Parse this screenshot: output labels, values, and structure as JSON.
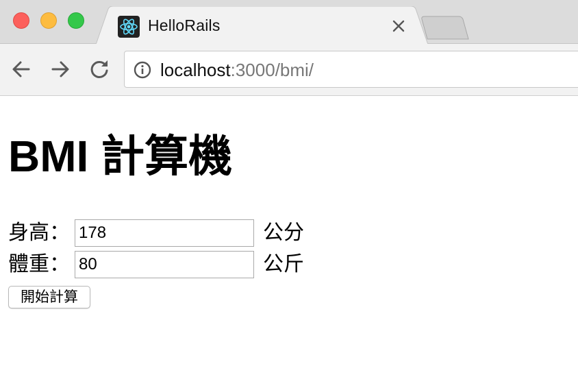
{
  "browser": {
    "tab": {
      "title": "HelloRails",
      "favicon": "react-atom-icon"
    },
    "address_bar": {
      "host": "localhost",
      "rest": ":3000/bmi/"
    },
    "icons": {
      "back": "arrow-left-icon",
      "forward": "arrow-right-icon",
      "reload": "reload-icon",
      "site_info": "info-icon",
      "tab_close": "close-icon"
    },
    "colors": {
      "close": "#fc605c",
      "minimize": "#fdbc40",
      "maximize": "#34c84a",
      "react": "#61dafb"
    }
  },
  "page": {
    "title": "BMI 計算機",
    "form": {
      "height": {
        "label": "身高：",
        "value": "178",
        "unit": "公分"
      },
      "weight": {
        "label": "體重：",
        "value": "80",
        "unit": "公斤"
      },
      "submit_label": "開始計算"
    }
  }
}
